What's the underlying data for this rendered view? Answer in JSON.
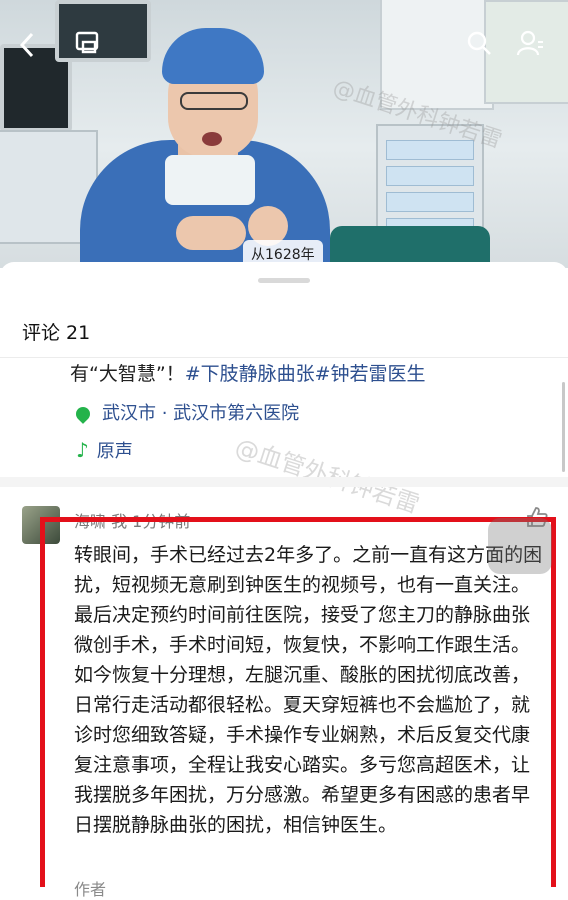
{
  "video": {
    "back_icon": "chevron-left-icon",
    "cast_icon": "screen-cast-icon",
    "search_icon": "search-icon",
    "profile_icon": "person-icon",
    "watermark_text": "@血管外科钟若雷",
    "source_tag": "从1628年"
  },
  "comments_panel": {
    "title": "评论 21",
    "description": {
      "prefix": "有“大智慧”！",
      "hashtag1": "#下肢静脉曲张",
      "hashtag2": "#钟若雷医生"
    },
    "location": "武汉市 · 武汉市第六医院",
    "music": "原声",
    "watermark_text": "@血管外科钟若雷"
  },
  "comment": {
    "author": "海啸 我 1分钟前",
    "text": "转眼间，手术已经过去2年多了。之前一直有这方面的困扰，短视频无意刷到钟医生的视频号，也有一直关注。最后决定预约时间前往医院，接受了您主刀的静脉曲张微创手术，手术时间短，恢复快，不影响工作跟生活。如今恢复十分理想，左腿沉重、酸胀的困扰彻底改善，日常行走活动都很轻松。夏天穿短裤也不会尴尬了，就诊时您细致答疑，手术操作专业娴熟，术后反复交代康复注意事项，全程让我安心踏实。多亏您高超医术，让我摆脱多年困扰，万分感激。希望更多有困惑的患者早日摆脱静脉曲张的困扰，相信钟医生。",
    "tail": "作者"
  },
  "colors": {
    "highlight_box": "#e3101a",
    "link": "#2d4f8f",
    "green_icon": "#24b34b"
  }
}
